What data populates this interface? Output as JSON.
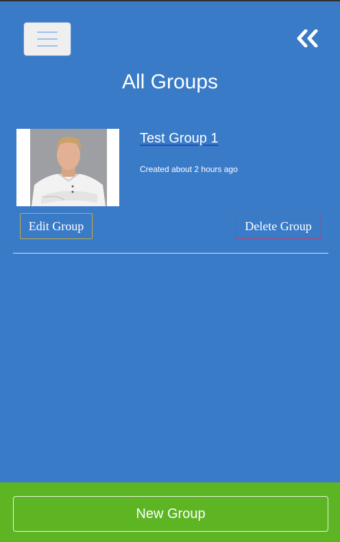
{
  "header": {
    "menu_icon": "hamburger-icon",
    "back_icon": "double-chevron-left-icon",
    "title": "All Groups"
  },
  "groups": [
    {
      "name": "Test Group 1",
      "created": "Created about 2 hours ago",
      "image_icon": "chef-portrait-photo",
      "edit_label": "Edit Group",
      "delete_label": "Delete Group"
    }
  ],
  "footer": {
    "new_group_label": "New Group"
  },
  "colors": {
    "background": "#3a7bc8",
    "footer": "#5db524",
    "edit_border": "#c9a93a",
    "delete_border": "#c0406a"
  }
}
